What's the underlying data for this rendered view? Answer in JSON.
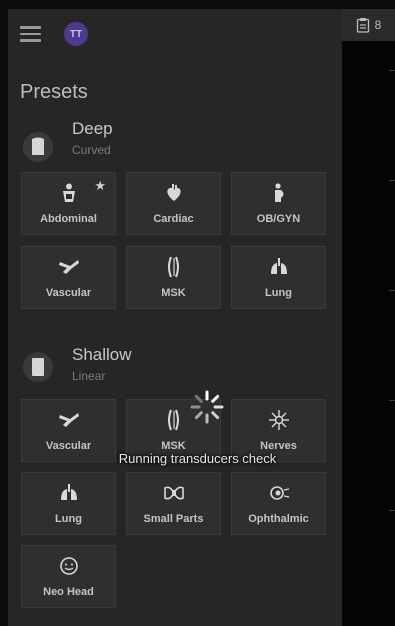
{
  "header": {
    "avatar_initials": "TT",
    "right_badge_count": "8"
  },
  "drawer": {
    "title": "Presets",
    "sections": [
      {
        "name": "Deep",
        "sub": "Curved",
        "presets": [
          {
            "label": "Abdominal",
            "icon": "abdomen-icon",
            "starred": "★"
          },
          {
            "label": "Cardiac",
            "icon": "heart-icon"
          },
          {
            "label": "OB/GYN",
            "icon": "pregnancy-icon"
          },
          {
            "label": "Vascular",
            "icon": "vessel-icon"
          },
          {
            "label": "MSK",
            "icon": "musculoskeletal-icon"
          },
          {
            "label": "Lung",
            "icon": "lungs-icon"
          }
        ]
      },
      {
        "name": "Shallow",
        "sub": "Linear",
        "presets": [
          {
            "label": "Vascular",
            "icon": "vessel-icon"
          },
          {
            "label": "MSK",
            "icon": "musculoskeletal-icon"
          },
          {
            "label": "Nerves",
            "icon": "nerve-icon"
          },
          {
            "label": "Lung",
            "icon": "lungs-icon"
          },
          {
            "label": "Small Parts",
            "icon": "small-parts-icon"
          },
          {
            "label": "Ophthalmic",
            "icon": "eye-icon"
          },
          {
            "label": "Neo Head",
            "icon": "baby-head-icon"
          }
        ]
      }
    ]
  },
  "overlay": {
    "status_text": "Running transducers check"
  },
  "colors": {
    "drawer_bg": "#262626",
    "tile_bg": "#2f2f2f",
    "avatar_bg": "#4d3a8a"
  }
}
